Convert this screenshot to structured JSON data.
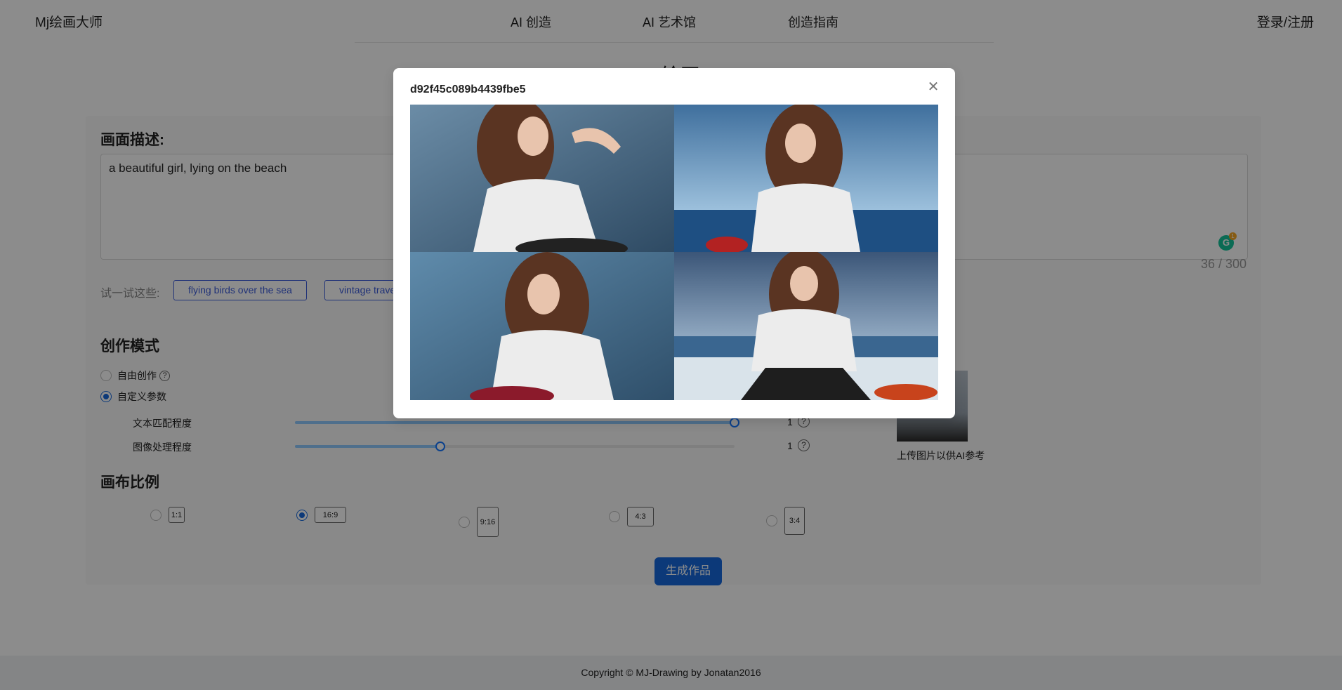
{
  "header": {
    "logo": "Mj绘画大师",
    "nav": [
      "AI 创造",
      "AI 艺术馆",
      "创造指南"
    ],
    "login": "登录/注册"
  },
  "page_title": "AI绘画",
  "prompt": {
    "label": "画面描述:",
    "value": "a beautiful girl, lying on the beach",
    "counter": "36 / 300",
    "grammarly_count": "1"
  },
  "suggestions": {
    "label": "试一试这些:",
    "chips": [
      "flying birds over the sea",
      "vintage trave"
    ]
  },
  "mode": {
    "title": "创作模式",
    "options": [
      {
        "label": "自由创作",
        "checked": false
      },
      {
        "label": "自定义参数",
        "checked": true
      }
    ],
    "sliders": [
      {
        "label": "文本匹配程度",
        "value": "1",
        "fill": 1.0
      },
      {
        "label": "图像处理程度",
        "value": "1",
        "fill": 0.33
      }
    ],
    "upload_label": "上传图片以供AI参考"
  },
  "canvas": {
    "title": "画布比例",
    "ratios": [
      {
        "label": "1:1",
        "checked": false
      },
      {
        "label": "16:9",
        "checked": true
      },
      {
        "label": "9:16",
        "checked": false
      },
      {
        "label": "4:3",
        "checked": false
      },
      {
        "label": "3:4",
        "checked": false
      }
    ]
  },
  "generate_button": "生成作品",
  "footer": "Copyright © MJ-Drawing by Jonatan2016",
  "modal": {
    "title": "d92f45c089b4439fbe5",
    "close_icon": "close-icon"
  },
  "colors": {
    "primary": "#1668dc",
    "chip": "#3b5bdb"
  }
}
